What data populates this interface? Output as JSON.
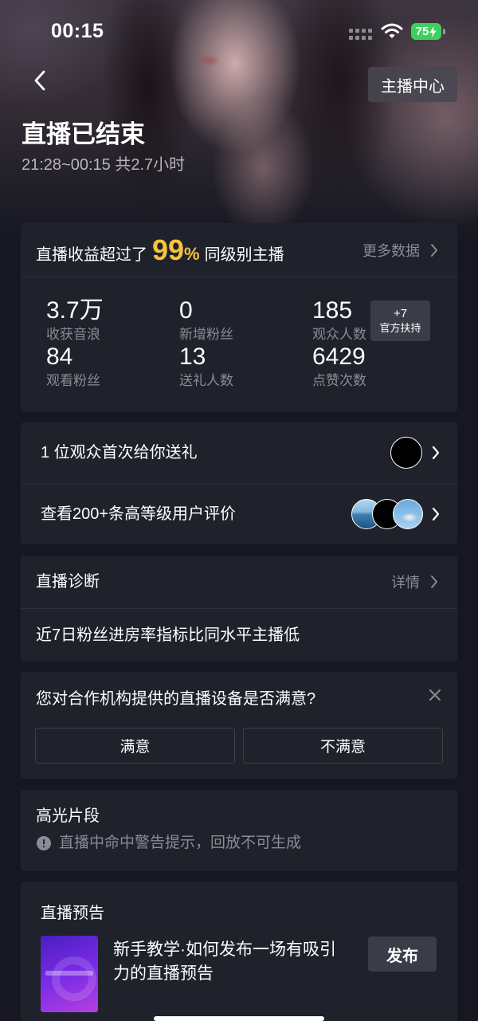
{
  "status_bar": {
    "time": "00:15",
    "battery_level": "75",
    "signal_icon": "signal-dots-icon",
    "wifi_icon": "wifi-icon",
    "battery_icon": "battery-charging-icon"
  },
  "header": {
    "back_icon": "chevron-left-icon",
    "anchor_center": "主播中心",
    "title": "直播已结束",
    "subtitle": "21:28~00:15 共2.7小时"
  },
  "summary": {
    "headline_prefix": "直播收益超过了",
    "headline_percent": "99",
    "headline_percent_sign": "%",
    "headline_suffix": "同级别主播",
    "more_data": "更多数据",
    "stats": [
      {
        "value": "3.7",
        "unit": "万",
        "label": "收获音浪"
      },
      {
        "value": "0",
        "label": "新增粉丝"
      },
      {
        "value": "185",
        "label": "观众人数"
      },
      {
        "value": "84",
        "label": "观看粉丝"
      },
      {
        "value": "13",
        "label": "送礼人数"
      },
      {
        "value": "6429",
        "label": "点赞次数"
      }
    ],
    "support_badge": {
      "value": "+7",
      "label": "官方扶持"
    }
  },
  "gifts_row": {
    "text": "1 位观众首次给你送礼"
  },
  "reviews_row": {
    "text": "查看200+条高等级用户评价"
  },
  "diagnosis": {
    "title": "直播诊断",
    "details": "详情",
    "message": "近7日粉丝进房率指标比同水平主播低"
  },
  "survey": {
    "question": "您对合作机构提供的直播设备是否满意?",
    "options": [
      "满意",
      "不满意"
    ]
  },
  "highlights": {
    "title": "高光片段",
    "notice": "直播中命中警告提示，回放不可生成"
  },
  "preview": {
    "title": "直播预告",
    "tutorial_title": "新手教学·如何发布一场有吸引力的直播预告",
    "publish": "发布"
  },
  "colors": {
    "background": "#161722",
    "card": "#1f212b",
    "accent": "#f7c33d",
    "muted_text": "#8a8b94",
    "battery": "#3dd15b"
  }
}
